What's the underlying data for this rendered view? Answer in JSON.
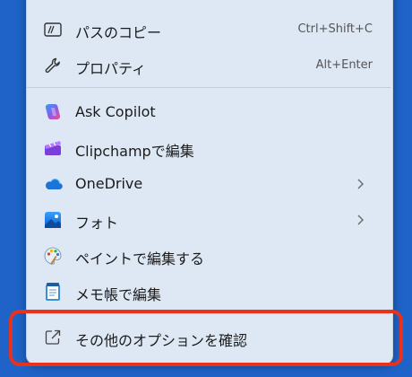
{
  "menu": {
    "items": [
      {
        "label": "パスのコピー",
        "shortcut": "Ctrl+Shift+C",
        "icon": "copy-path-icon"
      },
      {
        "label": "プロパティ",
        "shortcut": "Alt+Enter",
        "icon": "wrench-icon"
      },
      {
        "label": "Ask Copilot",
        "icon": "copilot-icon"
      },
      {
        "label": "Clipchampで編集",
        "icon": "clipchamp-icon"
      },
      {
        "label": "OneDrive",
        "icon": "onedrive-icon",
        "submenu": true
      },
      {
        "label": "フォト",
        "icon": "photos-icon",
        "submenu": true
      },
      {
        "label": "ペイントで編集する",
        "icon": "paint-icon"
      },
      {
        "label": "メモ帳で編集",
        "icon": "notepad-icon"
      },
      {
        "label": "その他のオプションを確認",
        "icon": "more-options-icon"
      }
    ]
  },
  "colors": {
    "desktop": "#1f63c8",
    "menu_bg": "#dde8f4",
    "highlight": "#e8321c"
  }
}
